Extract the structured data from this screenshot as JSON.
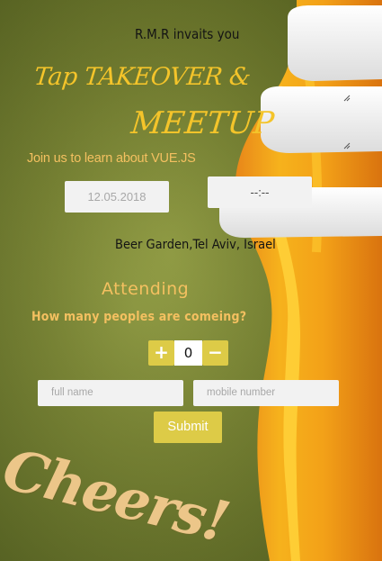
{
  "invite_text": "R.M.R invaits you",
  "title": {
    "line1": "Tap TAKEOVER &",
    "line2": "MEETUP"
  },
  "subtitle": "Join us to learn about VUE.JS",
  "date_field": {
    "value": "12.05.2018"
  },
  "time_field": {
    "value": "--:--"
  },
  "location": "Beer Garden,Tel Aviv, Israel",
  "attending": {
    "heading": "Attending",
    "question": "How many peoples are comeing?",
    "increment_label": "+",
    "decrement_label": "−",
    "count": "0"
  },
  "form": {
    "name_placeholder": "full name",
    "mobile_placeholder": "mobile number",
    "submit_label": "Submit"
  },
  "decor": {
    "cheers_text": "Cheers!"
  },
  "colors": {
    "background": "#76822d",
    "title_yellow": "#f4c42a",
    "accent_text": "#f4c060",
    "button": "#ddcb47",
    "beer_amber": "#f2a11a",
    "foam": "#f6f6f6"
  }
}
